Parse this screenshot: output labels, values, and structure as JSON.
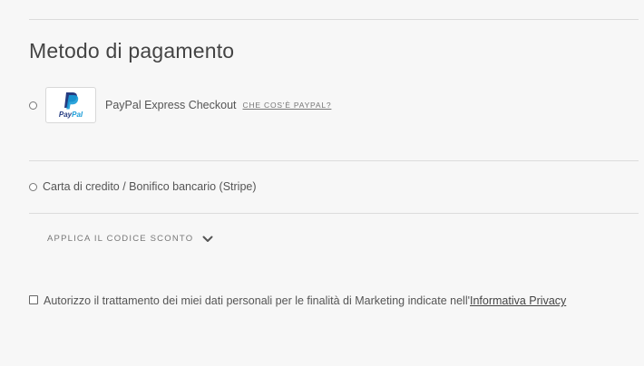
{
  "payment": {
    "title": "Metodo di pagamento",
    "options": [
      {
        "label": "PayPal Express Checkout",
        "link": "CHE COS'È PAYPAL?",
        "logo_text_pay": "Pay",
        "logo_text_pal": "Pal",
        "icon": "paypal-logo",
        "selected": false
      },
      {
        "label": "Carta di credito / Bonifico bancario (Stripe)",
        "selected": false
      }
    ]
  },
  "coupon": {
    "label": "APPLICA IL CODICE SCONTO",
    "icon": "chevron-down-icon"
  },
  "consent": {
    "text": "Autorizzo il trattamento dei miei dati personali per le finalità di Marketing indicate nell'",
    "link": "Informativa Privacy",
    "checked": false
  },
  "colors": {
    "background": "#f7f7f7",
    "divider": "#dcdcdc",
    "paypal_dark": "#253b80",
    "paypal_light": "#179bd7"
  }
}
